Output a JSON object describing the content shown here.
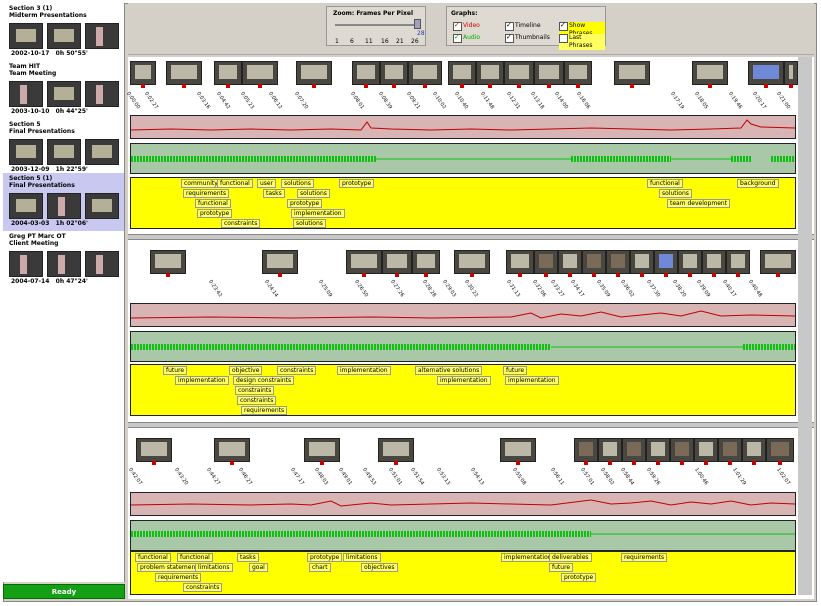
{
  "sessions": [
    {
      "title": "Section 3 (1)\nMidterm Presentations",
      "date": "2002-10-17",
      "duration": "0h 50\"55'"
    },
    {
      "title": "Team HIT\nTeam Meeting",
      "date": "2003-10-10",
      "duration": "0h 44\"25'"
    },
    {
      "title": "Section 5\nFinal Presentations",
      "date": "2003-12-09",
      "duration": "1h 22\"59'"
    },
    {
      "title": "Section 5 (1)\nFinal Presentations",
      "date": "2004-03-03",
      "duration": "1h 02\"06'"
    },
    {
      "title": "Greg PT Marc OT\nClient Meeting",
      "date": "2004-07-14",
      "duration": "0h 47\"24'"
    }
  ],
  "status": "Ready",
  "zoom": {
    "label": "Zoom: Frames Per Pixel",
    "ticks": [
      "1",
      "6",
      "11",
      "16",
      "21",
      "26"
    ],
    "value": "28"
  },
  "graphs": {
    "label": "Graphs:",
    "items": [
      {
        "label": "Video",
        "checked": true,
        "color": "#cc0000"
      },
      {
        "label": "Timeline",
        "checked": true,
        "color": "#000000"
      },
      {
        "label": "Show Phrases",
        "checked": true,
        "color": "#cccc00"
      },
      {
        "label": "Audio",
        "checked": true,
        "color": "#00aa00"
      },
      {
        "label": "Thumbnails",
        "checked": true,
        "color": "#000000"
      },
      {
        "label": "Last Phrases",
        "checked": false,
        "color": "#cccc00"
      }
    ]
  },
  "rows": [
    {
      "times": [
        "0:00:00",
        "0:02:27",
        "0:03:16",
        "0:04:42",
        "0:05:23",
        "0:06:12",
        "0:07:20",
        "0:08:01",
        "0:08:39",
        "0:09:21",
        "0:10:02",
        "0:10:40",
        "0:11:48",
        "0:12:31",
        "0:13:18",
        "0:14:00",
        "0:16:06",
        "0:17:19",
        "0:18:05",
        "0:19:46",
        "0:20:17",
        "0:21:00"
      ],
      "keywords": [
        {
          "t": "community"
        },
        {
          "t": "functional"
        },
        {
          "t": "user"
        },
        {
          "t": "solutions"
        },
        {
          "t": "prototype"
        },
        {
          "t": "requirements"
        },
        {
          "t": "tasks"
        },
        {
          "t": "solutions"
        },
        {
          "t": "functional"
        },
        {
          "t": "prototype"
        },
        {
          "t": "prototype"
        },
        {
          "t": "implementation"
        },
        {
          "t": "constraints"
        },
        {
          "t": "solutions"
        },
        {
          "t": "functional"
        },
        {
          "t": "background"
        },
        {
          "t": "solutions"
        },
        {
          "t": "team development"
        }
      ]
    },
    {
      "times": [
        "0:23:42",
        "0:24:14",
        "0:25:09",
        "0:26:50",
        "0:27:26",
        "0:28:28",
        "0:29:03",
        "0:30:22",
        "0:31:13",
        "0:32:06",
        "0:33:27",
        "0:34:17",
        "0:35:09",
        "0:36:02",
        "0:37:30",
        "0:38:20",
        "0:39:09",
        "0:40:17",
        "0:40:48"
      ],
      "keywords": [
        {
          "t": "future"
        },
        {
          "t": "objective"
        },
        {
          "t": "constraints"
        },
        {
          "t": "implementation"
        },
        {
          "t": "alternative solutions"
        },
        {
          "t": "future"
        },
        {
          "t": "implementation"
        },
        {
          "t": "design constraints"
        },
        {
          "t": "implementation"
        },
        {
          "t": "implementation"
        },
        {
          "t": "constraints"
        },
        {
          "t": "constraints"
        },
        {
          "t": "requirements"
        }
      ]
    },
    {
      "times": [
        "0:42:07",
        "0:43:20",
        "0:44:27",
        "0:46:27",
        "0:47:17",
        "0:48:03",
        "0:49:01",
        "0:49:53",
        "0:51:01",
        "0:51:54",
        "0:53:13",
        "0:54:13",
        "0:55:08",
        "0:56:11",
        "0:57:01",
        "0:58:02",
        "0:58:44",
        "0:59:26",
        "1:00:46",
        "1:01:29",
        "1:02:07"
      ],
      "keywords": [
        {
          "t": "functional"
        },
        {
          "t": "functional"
        },
        {
          "t": "tasks"
        },
        {
          "t": "prototype"
        },
        {
          "t": "limitations"
        },
        {
          "t": "implementation"
        },
        {
          "t": "deliverables"
        },
        {
          "t": "requirements"
        },
        {
          "t": "problem statement"
        },
        {
          "t": "limitations"
        },
        {
          "t": "goal"
        },
        {
          "t": "chart"
        },
        {
          "t": "objectives"
        },
        {
          "t": "future"
        },
        {
          "t": "requirements"
        },
        {
          "t": "prototype"
        },
        {
          "t": "constraints"
        }
      ]
    }
  ]
}
